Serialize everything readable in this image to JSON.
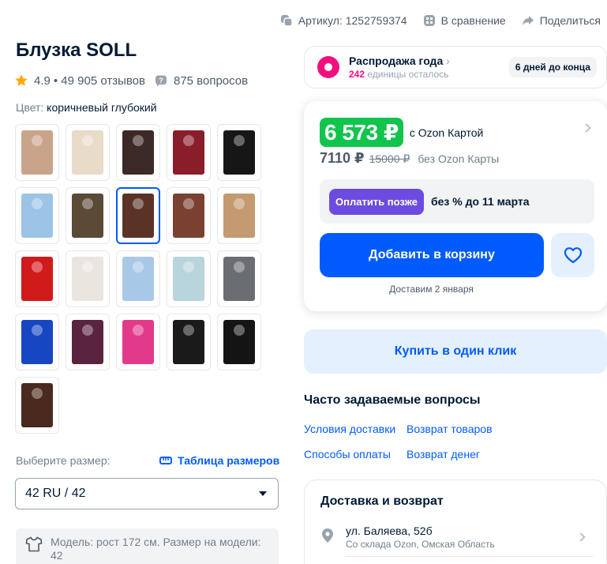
{
  "topbar": {
    "article": "Артикул: 1252759374",
    "compare": "В сравнение",
    "share": "Поделиться"
  },
  "product": {
    "title": "Блузка SOLL",
    "rating": "4.9",
    "reviews": "• 49 905 отзывов",
    "questions": "875 вопросов",
    "color_label": "Цвет:",
    "color_value": "коричневый глубокий"
  },
  "thumbnails": [
    {
      "color": "#c9a48a"
    },
    {
      "color": "#e8dcc8"
    },
    {
      "color": "#3b2a26"
    },
    {
      "color": "#8a1d2a"
    },
    {
      "color": "#161616"
    },
    {
      "color": "#9cc4e6"
    },
    {
      "color": "#5a4a36"
    },
    {
      "color": "#5a3326",
      "selected": true
    },
    {
      "color": "#7a4030"
    },
    {
      "color": "#c49a70"
    },
    {
      "color": "#d11a1a"
    },
    {
      "color": "#eae6df"
    },
    {
      "color": "#a8c8e8"
    },
    {
      "color": "#b8d4dc"
    },
    {
      "color": "#6a6e72"
    },
    {
      "color": "#1746c2"
    },
    {
      "color": "#5a2440"
    },
    {
      "color": "#e23a8a"
    },
    {
      "color": "#1a1a1a"
    },
    {
      "color": "#141414"
    },
    {
      "color": "#4a2a1e"
    }
  ],
  "size": {
    "label": "Выберите размер:",
    "table_link": "Таблица размеров",
    "selected": "42 RU / 42",
    "model_info": "Модель: рост 172 см. Размер на модели: 42"
  },
  "sale": {
    "title": "Распродажа года",
    "count": "242",
    "count_suffix": " единицы осталось",
    "days_left": "6 дней до конца"
  },
  "price": {
    "card_price": "6 573 ₽",
    "card_note": "с Ozon Картой",
    "price": "7110 ₽",
    "old_price": "15000 ₽",
    "price_note": "без Ozon Карты",
    "pay_later_button": "Оплатить позже",
    "pay_later_text": "без % до 11 марта",
    "add_to_cart": "Добавить в корзину",
    "delivery": "Доставим 2 января"
  },
  "one_click": "Купить в один клик",
  "faq": {
    "title": "Часто задаваемые вопросы",
    "links": [
      "Условия доставки",
      "Возврат товаров",
      "Способы оплаты",
      "Возврат денег"
    ]
  },
  "shipping": {
    "title": "Доставка и возврат",
    "address": "ул. Баляева, 52б",
    "warehouse": "Со склада Ozon, Омская Область"
  },
  "colors": {
    "accent": "#005bff",
    "sale_pink": "#f1117e",
    "price_green": "#10c44c",
    "pay_later": "#6c4ce0"
  }
}
